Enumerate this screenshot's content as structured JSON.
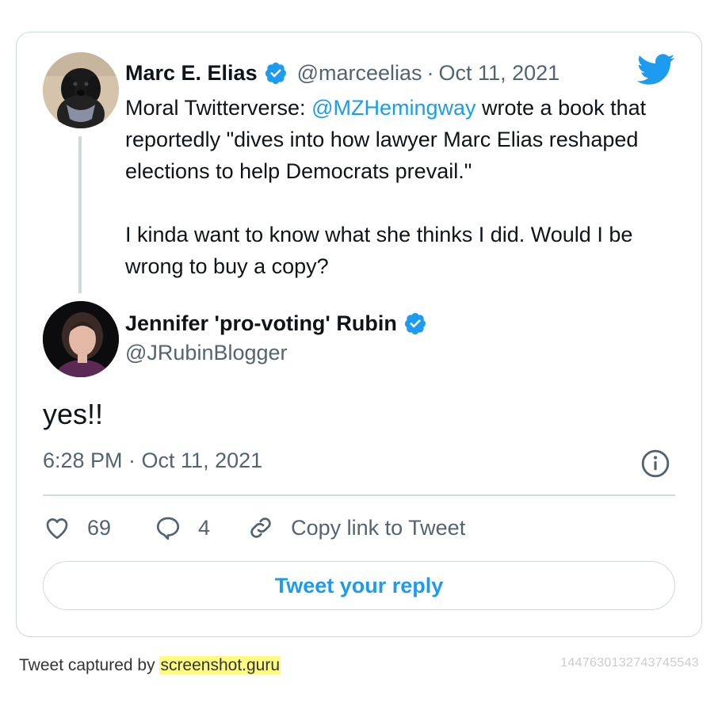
{
  "parent_tweet": {
    "author_name": "Marc E. Elias",
    "handle": "@marceelias",
    "separator": "·",
    "date": "Oct 11, 2021",
    "text_part1": "Moral Twitterverse: ",
    "mention": "@MZHemingway",
    "text_part2": " wrote a book that reportedly \"dives into how lawyer Marc Elias reshaped elections to help Democrats prevail.\"",
    "text_part3": "I kinda want to know what she thinks I did. Would I be wrong to buy a copy?"
  },
  "reply_tweet": {
    "author_name": "Jennifer 'pro-voting' Rubin",
    "handle": "@JRubinBlogger",
    "text": "yes!!",
    "timestamp": "6:28 PM · Oct 11, 2021"
  },
  "actions": {
    "likes": "69",
    "replies": "4",
    "copy_link_label": "Copy link to Tweet"
  },
  "reply_button_label": "Tweet your reply",
  "footer": {
    "captured_by": "Tweet captured by ",
    "site": "screenshot.guru",
    "tweet_id": "1447630132743745543"
  },
  "icons": {
    "brand": "twitter-bird-icon",
    "verified": "verified-badge-icon",
    "info": "info-icon",
    "like": "heart-icon",
    "reply": "speech-bubble-icon",
    "copy": "link-icon"
  },
  "colors": {
    "accent": "#1d9bf0",
    "secondary_text": "#536471",
    "border": "#cfd9de",
    "highlight": "#fffb80"
  }
}
